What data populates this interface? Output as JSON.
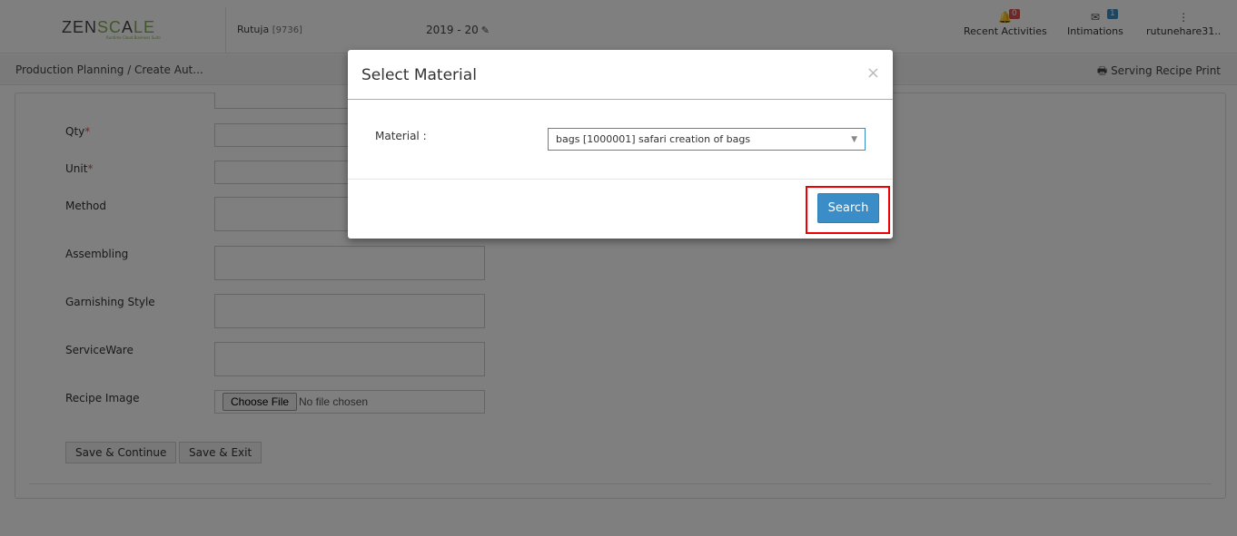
{
  "header": {
    "logo_left": "ZEN",
    "logo_mid": "SC",
    "logo_a": "A",
    "logo_right": "LE",
    "logo_tagline": "Runtime Cloud Business Suite",
    "user": "Rutuja",
    "user_code": "[9736]",
    "fiscal_year": "2019 - 20",
    "nav": {
      "recent_activities": "Recent Activities",
      "recent_badge": "0",
      "intimations": "Intimations",
      "intimations_badge": "1",
      "user_menu": "rutunehare31.."
    }
  },
  "breadcrumb": {
    "path": "Production Planning",
    "current": "/ Create Aut...",
    "print_label": "Serving Recipe Print"
  },
  "form": {
    "qty_label": "Qty",
    "unit_label": "Unit",
    "required_mark": "*",
    "method_label": "Method",
    "assembling_label": "Assembling",
    "garnishing_label": "Garnishing Style",
    "serviceware_label": "ServiceWare",
    "recipe_image_label": "Recipe Image",
    "choose_file": "Choose File",
    "no_file": "No file chosen",
    "save_continue": "Save & Continue",
    "save_exit": "Save & Exit"
  },
  "modal": {
    "title": "Select Material",
    "close": "×",
    "material_label": "Material :",
    "material_value": "bags [1000001] safari creation of bags",
    "search_button": "Search"
  },
  "colors": {
    "primary": "#3a8dc6",
    "highlight": "#e00000",
    "logo_green": "#7fb14a"
  }
}
